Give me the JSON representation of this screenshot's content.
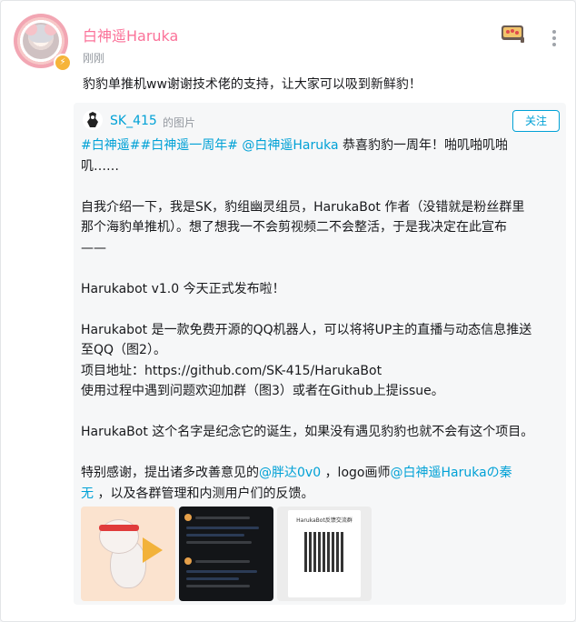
{
  "post": {
    "username": "白神遥Haruka",
    "time": "刚刚",
    "text": "豹豹单推机ww谢谢技术佬的支持，让大家可以吸到新鲜豹！"
  },
  "repost": {
    "username": "SK_415",
    "type_label": "的图片",
    "follow_label": "关注",
    "lines": {
      "l1_tag1": "#白神遥#",
      "l1_tag2": "#白神遥一周年#",
      "l1_mention": "@白神遥Haruka",
      "l1_rest": "恭喜豹豹一周年！啪叽啪叽啪",
      "l2": "叽……",
      "p2a": "自我介绍一下，我是SK，豹组幽灵组员，HarukaBot 作者（没错就是粉丝群里",
      "p2b": "那个海豹单推机）。想了想我一不会剪视频二不会整活，于是我决定在此宣布",
      "p2c": "——",
      "p3": "Harukabot v1.0 今天正式发布啦！",
      "p4a": "Harukabot 是一款免费开源的QQ机器人，可以将将UP主的直播与动态信息推送",
      "p4b": "至QQ（图2）。",
      "p4c": "项目地址：https://github.com/SK-415/HarukaBot",
      "p4d": "使用过程中遇到问题欢迎加群（图3）或者在Github上提issue。",
      "p5": "HarukaBot 这个名字是纪念它的诞生，如果没有遇见豹豹也就不会有这个项目。",
      "p6_pre": "特别感谢，提出诸多改善意见的",
      "p6_m1": "@胖达0v0",
      "p6_mid": "，logo画师",
      "p6_m2a": "@白神遥Harukaの秦",
      "p6_m2b": "无",
      "p6_post": "，以及各群管理和内测用户们的反馈。"
    },
    "images": [
      {
        "icon": "seal-mascot-image"
      },
      {
        "icon": "chat-screenshot-image"
      },
      {
        "icon": "qr-code-image",
        "title": "HarukaBot反馈交流群"
      }
    ]
  },
  "colors": {
    "accent_pink": "#fb7299",
    "link_blue": "#00a1d6",
    "muted": "#9499a0"
  }
}
